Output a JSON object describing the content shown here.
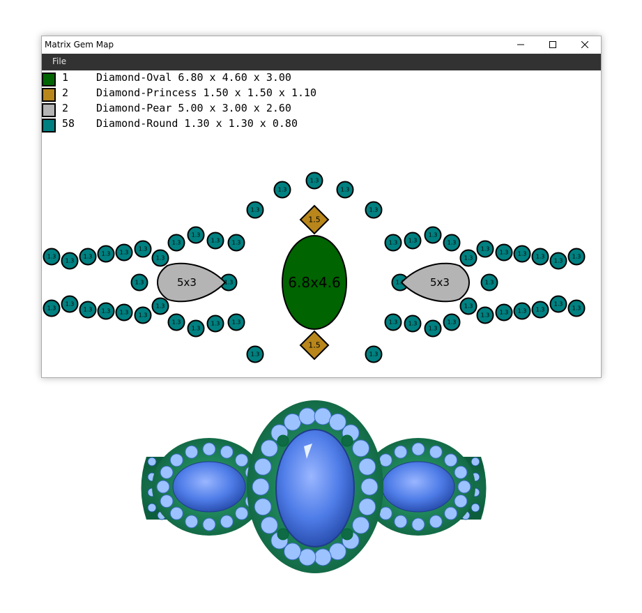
{
  "window": {
    "title": "Matrix Gem Map"
  },
  "menu": {
    "file": "File"
  },
  "legend": [
    {
      "color": "#006400",
      "count": "1",
      "description": "Diamond-Oval 6.80 x 4.60 x 3.00"
    },
    {
      "color": "#b8861b",
      "count": "2",
      "description": "Diamond-Princess 1.50 x 1.50 x 1.10"
    },
    {
      "color": "#b4b4b4",
      "count": "2",
      "description": "Diamond-Pear 5.00 x 3.00 x 2.60"
    },
    {
      "color": "#008080",
      "count": "58",
      "description": "Diamond-Round 1.30 x 1.30 x 0.80"
    }
  ],
  "gems": {
    "oval_label": "6.8x4.6",
    "princess_label": "1.5",
    "pear_label": "5x3",
    "round_label": "1.3"
  },
  "colors": {
    "oval": "#006400",
    "princess": "#b8861b",
    "pear": "#b4b4b4",
    "round": "#008080",
    "menubar": "#323232",
    "ring_metal": "#1a8a5a",
    "ring_stone": "#5b8cf0",
    "ring_accent": "#9cc2ff"
  }
}
